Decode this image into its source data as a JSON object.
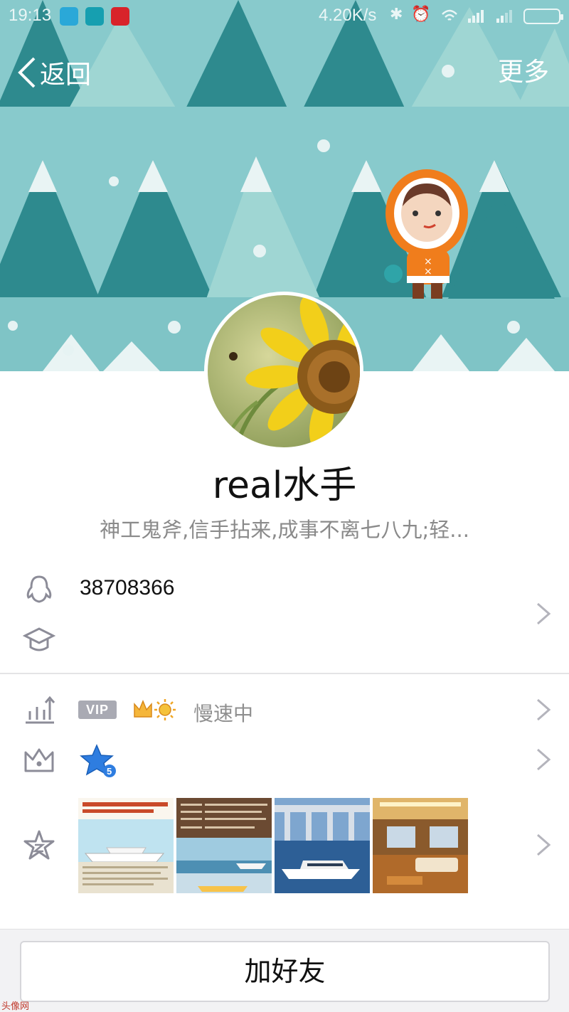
{
  "status_bar": {
    "time": "19:13",
    "network_speed": "4.20K/s"
  },
  "nav": {
    "back_label": "返回",
    "more_label": "更多"
  },
  "profile": {
    "nickname": "real水手",
    "signature": "神工鬼斧,信手拈来,成事不离七八九;轻...",
    "qq_number": "38708366"
  },
  "vip": {
    "badge": "VIP",
    "status": "慢速中"
  },
  "actions": {
    "add_friend": "加好友"
  },
  "watermark": "头像网",
  "colors": {
    "banner_bg": "#88cacc",
    "tree_dark": "#2e8a8e",
    "tree_light": "#9fd6d3",
    "icon_gray": "#8c8c98"
  },
  "icons": [
    "back-chevron",
    "qq-penguin",
    "graduation-cap",
    "stats-arrow",
    "crown",
    "qzone-star",
    "chevron-right"
  ]
}
